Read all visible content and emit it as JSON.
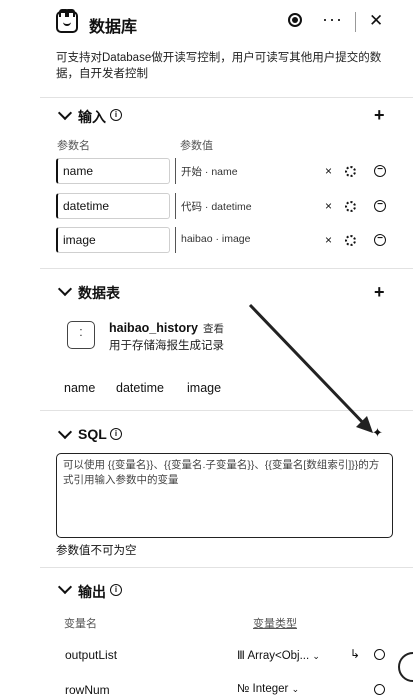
{
  "header": {
    "title": "数据库",
    "description": "可支持对Database做开读写控制，用户可读写其他用户提交的数据，自开发者控制"
  },
  "input_section": {
    "title": "输入",
    "col_name": "参数名",
    "col_value": "参数值",
    "rows": [
      {
        "name": "name",
        "value_prefix": "开始 ·",
        "value": "name"
      },
      {
        "name": "datetime",
        "value_prefix": "代码 ·",
        "value": "datetime"
      },
      {
        "name": "image",
        "value_prefix": "haibao ·",
        "value": "image"
      }
    ]
  },
  "table_section": {
    "title": "数据表",
    "table_name": "haibao_history",
    "table_tag": "查看",
    "table_desc": "用于存储海报生成记录",
    "fields": [
      "name",
      "datetime",
      "image"
    ]
  },
  "sql_section": {
    "title": "SQL",
    "placeholder": "可以使用 {{变量名}}、{{变量名.子变量名}}、{{变量名[数组索引]}}的方式引用输入参数中的变量",
    "note": "参数值不可为空"
  },
  "output_section": {
    "title": "输出",
    "col_name": "变量名",
    "col_type": "变量类型",
    "rows": [
      {
        "name": "outputList",
        "type": "Array<Obj...",
        "type_icon": "Ⅲ"
      },
      {
        "name": "rowNum",
        "type": "Integer",
        "type_icon": "№"
      }
    ]
  }
}
